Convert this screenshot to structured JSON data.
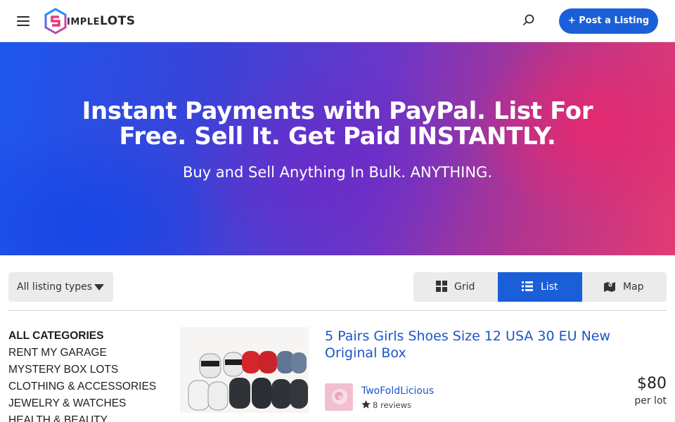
{
  "header": {
    "logo": {
      "initial": "S",
      "text_main": "IMPLE",
      "text_accent": "LOTS"
    },
    "post_button_label": "+ Post a Listing"
  },
  "hero": {
    "title": "Instant Payments with PayPal. List For Free. Sell It. Get Paid INSTANTLY.",
    "subtitle": "Buy and Sell Anything In Bulk. ANYTHING."
  },
  "controls": {
    "listing_type": "All listing types",
    "views": [
      {
        "label": "Grid",
        "icon": "grid-icon",
        "active": false
      },
      {
        "label": "List",
        "icon": "list-icon",
        "active": true
      },
      {
        "label": "Map",
        "icon": "map-icon",
        "active": false
      }
    ]
  },
  "categories": [
    {
      "label": "ALL CATEGORIES",
      "active": true
    },
    {
      "label": "RENT MY GARAGE",
      "active": false
    },
    {
      "label": "MYSTERY BOX LOTS",
      "active": false
    },
    {
      "label": "CLOTHING & ACCESSORIES",
      "active": false
    },
    {
      "label": "JEWELRY & WATCHES",
      "active": false
    },
    {
      "label": "HEALTH & BEAUTY",
      "active": false
    }
  ],
  "listing": {
    "title": "5 Pairs Girls Shoes Size 12 USA 30 EU New Original Box",
    "seller": {
      "name": "TwoFoldLicious",
      "reviews": "8 reviews"
    },
    "price": "$80",
    "price_unit": "per lot"
  },
  "colors": {
    "primary": "#1a5fd8",
    "link": "#1a56c9",
    "hero_left": "#1c57ee",
    "hero_right": "#e43a72"
  }
}
